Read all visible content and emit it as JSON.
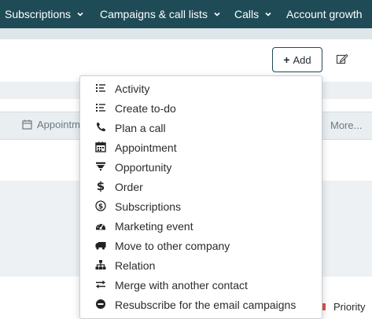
{
  "nav": {
    "items": [
      {
        "label": "Subscriptions",
        "icon": "chevron-down-icon"
      },
      {
        "label": "Campaigns & call lists",
        "icon": "chevron-down-icon"
      },
      {
        "label": "Calls",
        "icon": "chevron-down-icon"
      },
      {
        "label": "Account growth"
      }
    ]
  },
  "toolbar": {
    "add_label": "Add",
    "add_icon": "plus-icon",
    "edit_icon": "edit-icon"
  },
  "tabs": {
    "appointment_label": "Appointm",
    "more_label": "More..."
  },
  "priority_label": "Priority",
  "dropdown": {
    "items": [
      {
        "label": "Activity",
        "icon": "list-icon"
      },
      {
        "label": "Create to-do",
        "icon": "list-icon"
      },
      {
        "label": "Plan a call",
        "icon": "phone-icon"
      },
      {
        "label": "Appointment",
        "icon": "calendar-icon"
      },
      {
        "label": "Opportunity",
        "icon": "funnel-icon"
      },
      {
        "label": "Order",
        "icon": "dollar-icon"
      },
      {
        "label": "Subscriptions",
        "icon": "dollar-circle-icon"
      },
      {
        "label": "Marketing event",
        "icon": "dashboard-icon"
      },
      {
        "label": "Move to other company",
        "icon": "truck-icon"
      },
      {
        "label": "Relation",
        "icon": "sitemap-icon"
      },
      {
        "label": "Merge with another contact",
        "icon": "exchange-icon"
      },
      {
        "label": "Resubscribe for the email campaigns",
        "icon": "minus-circle-icon"
      }
    ]
  },
  "colors": {
    "nav_bg": "#1f4b57",
    "accent": "#1f4b57",
    "priority_flag": "#d9534f"
  }
}
